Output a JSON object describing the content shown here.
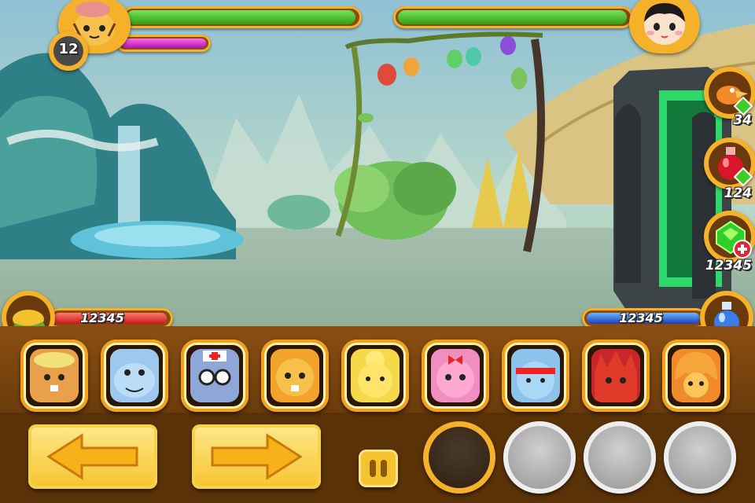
{
  "player": {
    "level": "12",
    "food_value": "12345"
  },
  "enemy": {},
  "items": {
    "bird_count": "34",
    "potion_count": "124",
    "gem_count": "12345",
    "mana_value": "12345"
  },
  "roster": [
    "chef-squirrel",
    "hippo",
    "nurse-mouse",
    "lion-cub",
    "yellow-bunny",
    "pink-hamster",
    "ninja-hamster",
    "red-hedgehog",
    "orange-beaver"
  ],
  "controls": {
    "left_arrow": "left-arrow",
    "right_arrow": "right-arrow"
  },
  "colors": {
    "hp": "#3dbb1c",
    "mana": "#c21fc0",
    "food": "#e23c2c",
    "water": "#2f5fd6",
    "gold": "#f6b12b"
  }
}
